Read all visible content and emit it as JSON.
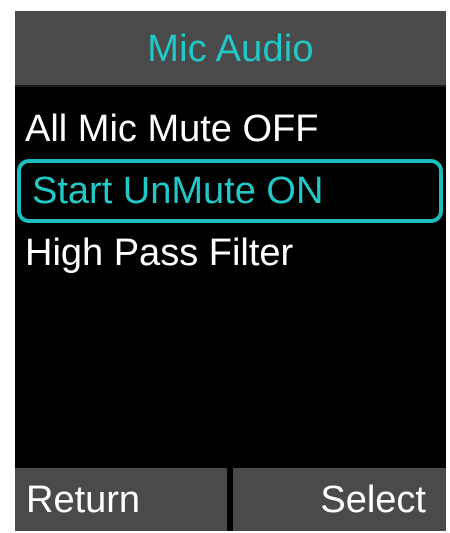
{
  "header": {
    "title": "Mic Audio"
  },
  "menu": {
    "items": [
      {
        "label": "All Mic Mute OFF"
      },
      {
        "label": "Start UnMute ON"
      },
      {
        "label": "High Pass Filter"
      }
    ],
    "selected_index": 1
  },
  "softkeys": {
    "left_label": "Return",
    "right_label": "Select"
  },
  "colors": {
    "background": "#000000",
    "bar": "#4a4a4a",
    "accent": "#22c7c7",
    "text": "#ffffff"
  }
}
